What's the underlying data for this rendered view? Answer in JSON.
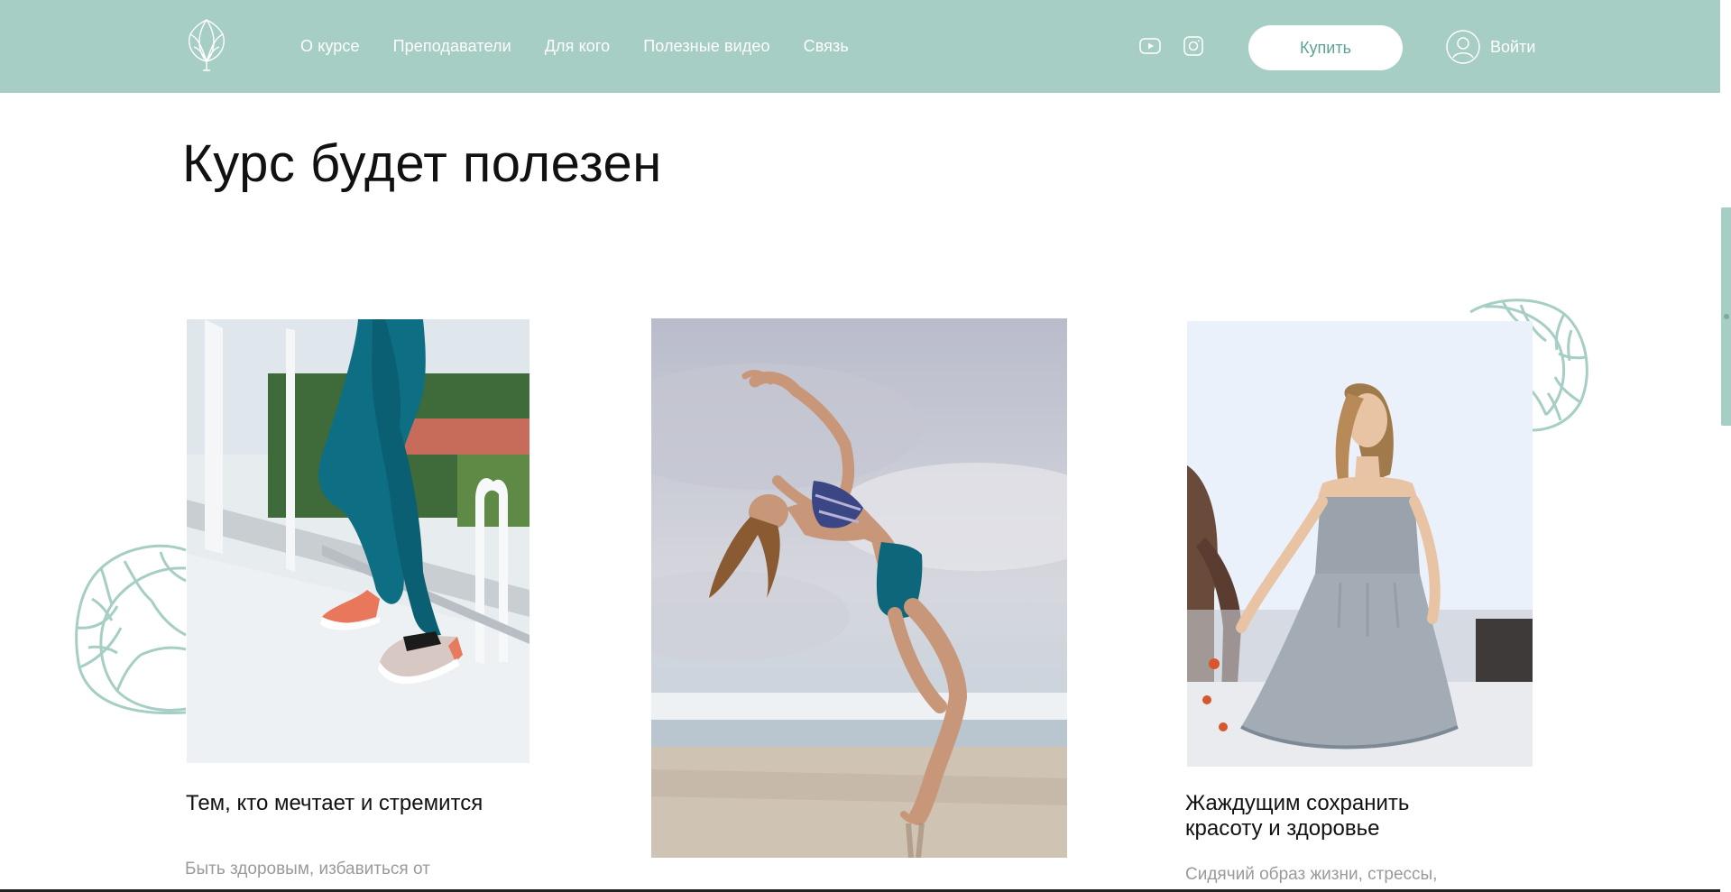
{
  "header": {
    "nav": [
      {
        "label": "О курсе"
      },
      {
        "label": "Преподаватели"
      },
      {
        "label": "Для кого"
      },
      {
        "label": "Полезные видео"
      },
      {
        "label": "Связь"
      }
    ],
    "social": [
      "youtube-icon",
      "instagram-icon"
    ],
    "buy_label": "Купить",
    "login_label": "Войти"
  },
  "section": {
    "title": "Курс будет полезен",
    "cards": [
      {
        "title": "Тем, кто мечтает и стремится",
        "description": "Быть здоровым, избавиться от",
        "image": "woman-climbing-stairs-photo"
      },
      {
        "title": "",
        "description": "",
        "image": "woman-backbend-on-beach-photo"
      },
      {
        "title": "Жаждущим сохранить красоту и здоровье",
        "description": "Сидячий образ жизни, стрессы,",
        "image": "woman-in-dress-photo"
      }
    ]
  },
  "colors": {
    "brand": "#a6cec5",
    "button_text": "#5aa396",
    "muted_text": "#9a9a9a"
  }
}
